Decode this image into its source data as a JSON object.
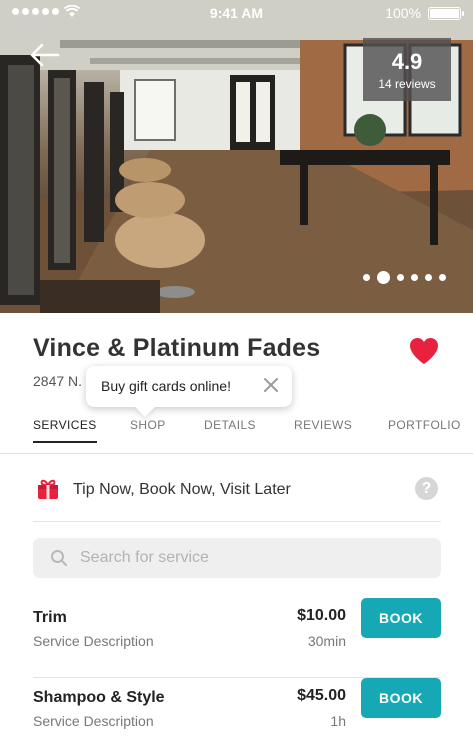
{
  "status_bar": {
    "time": "9:41 AM",
    "battery": "100%"
  },
  "hero": {
    "rating": "4.9",
    "reviews": "14 reviews",
    "slide_count": 6,
    "active_slide": 1
  },
  "business": {
    "name": "Vince & Platinum Fades",
    "address": "2847 N."
  },
  "tooltip": {
    "text": "Buy gift cards online!"
  },
  "tabs": [
    {
      "label": "SERVICES",
      "active": true
    },
    {
      "label": "SHOP",
      "active": false
    },
    {
      "label": "DETAILS",
      "active": false
    },
    {
      "label": "REVIEWS",
      "active": false
    },
    {
      "label": "PORTFOLIO",
      "active": false
    }
  ],
  "tip_row": {
    "label": "Tip Now, Book Now, Visit Later",
    "icon": "gift-icon",
    "help": "?"
  },
  "search": {
    "placeholder": "Search for service",
    "value": ""
  },
  "services": [
    {
      "name": "Trim",
      "description": "Service Description",
      "price": "$10.00",
      "duration": "30min",
      "button": "BOOK"
    },
    {
      "name": "Shampoo & Style",
      "description": "Service Description",
      "price": "$45.00",
      "duration": "1h",
      "button": "BOOK"
    }
  ],
  "colors": {
    "accent": "#17a8b5",
    "heart": "#e8213f",
    "gift": "#e8213f"
  }
}
